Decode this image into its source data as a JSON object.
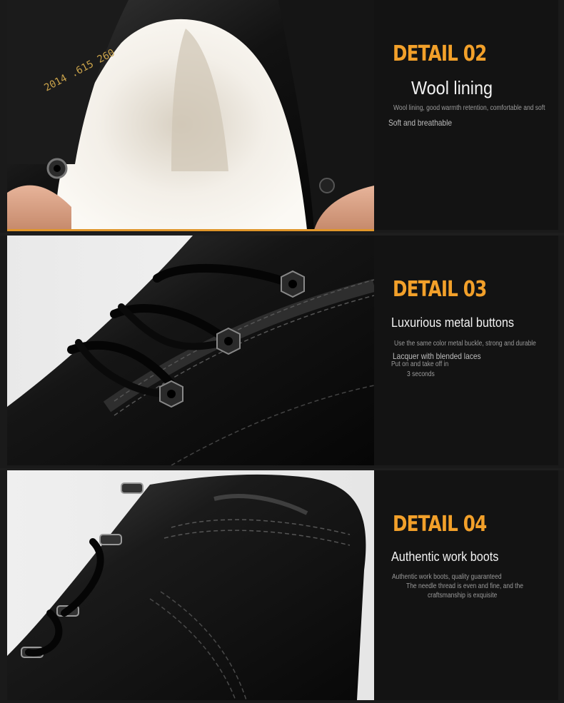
{
  "sections": [
    {
      "detail": "DETAIL 02",
      "title": "Wool lining",
      "lines": [
        "Wool lining, good warmth retention, comfortable and soft",
        "Soft and breathable"
      ],
      "photo_icon": "boot-wool-lining-photo",
      "stamp": "2014 .615 260"
    },
    {
      "detail": "DETAIL 03",
      "title": "Luxurious metal buttons",
      "lines": [
        "Use the same color metal buckle, strong and durable",
        "Lacquer with blended laces",
        "Put on and take off in",
        "3 seconds"
      ],
      "photo_icon": "boot-laces-eyelets-photo"
    },
    {
      "detail": "DETAIL 04",
      "title": "Authentic work boots",
      "lines": [
        "Authentic work boots, quality guaranteed",
        "The needle thread is even and fine, and the",
        "craftsmanship is exquisite"
      ],
      "photo_icon": "boot-collar-photo"
    }
  ],
  "colors": {
    "accent": "#f2a02a",
    "panel": "#131313",
    "leather": "#0e0e0e"
  }
}
